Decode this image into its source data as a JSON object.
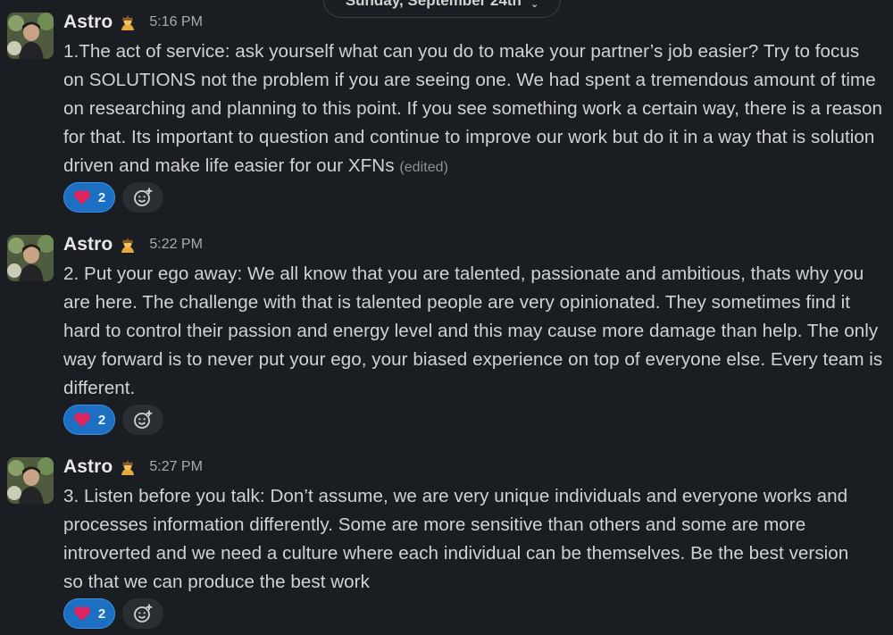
{
  "date_divider": {
    "label": "Sunday, September 24th"
  },
  "messages": [
    {
      "author": "Astro",
      "time": "5:16 PM",
      "text": "1.The act of service: ask yourself what can you do to make your partner’s job easier? Try to focus on SOLUTIONS not the problem if you are seeing one. We had spent a tremendous amount of time on researching and planning to this point. If you see something work a certain way, there is a reason for that. Its important to question and continue to improve our work but do it in a way that is solution driven and make life easier for our XFNs",
      "edited": "(edited)",
      "reaction": {
        "emoji": "heart-icon",
        "count": "2"
      }
    },
    {
      "author": "Astro",
      "time": "5:22 PM",
      "text": "2. Put your ego away: We all know that you are talented, passionate and ambitious, thats why you are here. The challenge with that is talented people are very opinionated. They sometimes find it hard to control their passion and energy level and this may cause more damage than help. The only way forward is to never put your ego, your biased experience on top of everyone else. Every team is different.",
      "reaction": {
        "emoji": "heart-icon",
        "count": "2"
      }
    },
    {
      "author": "Astro",
      "time": "5:27 PM",
      "text_before": "3. Listen before you talk: Don’t assume, we are very unique individuals and everyone works and processes information differently. Some are more sensitive than others and some are more introverted and we need a culture where each individual can be themselves. Be the best version",
      "text_after": "so that we can produce the best work",
      "reaction": {
        "emoji": "heart-icon",
        "count": "2"
      }
    }
  ],
  "colors": {
    "background": "#1a1d21",
    "reaction_pill": "#1d6fc2",
    "heart": "#e0245e"
  },
  "icons": {
    "status_emoji": "bowing-person-icon",
    "add_reaction": "add-reaction-icon",
    "date_chevron": "chevron-down-icon"
  }
}
